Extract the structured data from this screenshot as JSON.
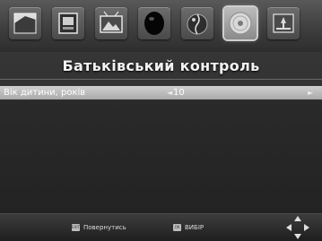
{
  "menu_icons": [
    {
      "name": "installation-icon",
      "active": false
    },
    {
      "name": "channel-manager-icon",
      "active": false
    },
    {
      "name": "picture-settings-icon",
      "active": false
    },
    {
      "name": "search-icon",
      "active": false
    },
    {
      "name": "time-icon",
      "active": false
    },
    {
      "name": "options-disc-icon",
      "active": true
    },
    {
      "name": "system-setup-icon",
      "active": false
    }
  ],
  "page": {
    "title": "Батьківський контроль"
  },
  "setting": {
    "label": "Вік дитини, років",
    "value": "10",
    "arrow_left": "◄",
    "arrow_right": "►"
  },
  "footer": {
    "back_key": "EXIT",
    "back_label": "Повернутись",
    "select_key": "OK",
    "select_label": "ВИБІР"
  },
  "colors": {
    "highlight_row": "#c4c4c4",
    "background": "#2a2a2a"
  }
}
